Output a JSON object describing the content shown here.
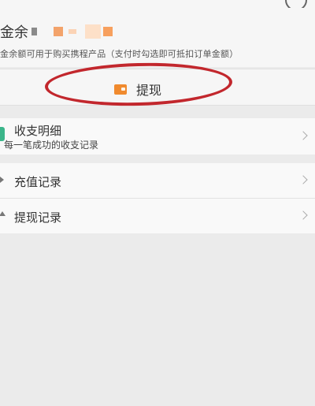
{
  "balance": {
    "label": "金余",
    "note": "金余额可用于购买携程产品（支付时勾选即可抵扣订单金额）"
  },
  "withdraw": {
    "label": "提现",
    "icon": "wallet-icon",
    "icon_color": "#f08a2e"
  },
  "annotation": {
    "color": "#c2272d"
  },
  "rows": [
    {
      "title": "收支明细",
      "subtitle": "每一笔成功的收支记录"
    },
    {
      "title": "充值记录"
    },
    {
      "title": "提现记录"
    }
  ],
  "colors": {
    "background": "#ebebeb",
    "card": "#f6f6f6",
    "accent_green": "#3bb58a"
  }
}
